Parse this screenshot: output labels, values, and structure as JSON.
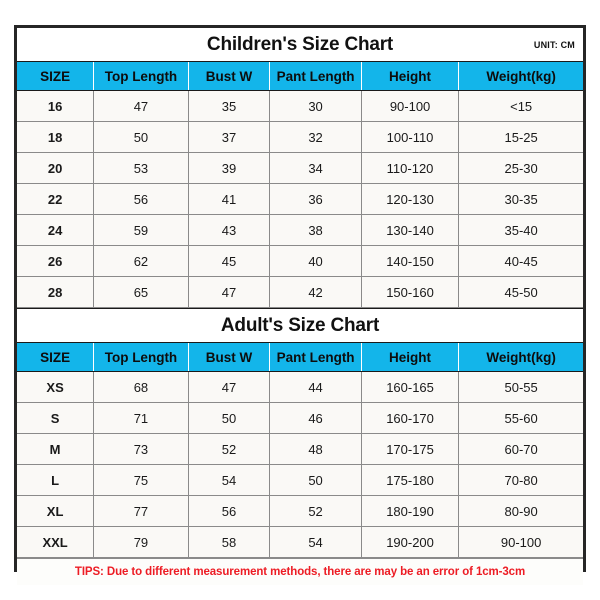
{
  "unit_note": "UNIT: CM",
  "columns": [
    "SIZE",
    "Top Length",
    "Bust W",
    "Pant Length",
    "Height",
    "Weight(kg)"
  ],
  "colors": {
    "header_blue": "#13B5EA",
    "cell_background": "#FAF9F6",
    "border_gray": "#8A8A8A",
    "outer_border": "#262626",
    "tips_red": "#ED1C24",
    "text_dark": "#1A1A1A"
  },
  "children_chart": {
    "title": "Children's Size Chart",
    "columns": [
      "SIZE",
      "Top Length",
      "Bust W",
      "Pant Length",
      "Height",
      "Weight(kg)"
    ],
    "rows": [
      {
        "size": "16",
        "top_length": "47",
        "bust_w": "35",
        "pant_length": "30",
        "height": "90-100",
        "weight": "<15"
      },
      {
        "size": "18",
        "top_length": "50",
        "bust_w": "37",
        "pant_length": "32",
        "height": "100-110",
        "weight": "15-25"
      },
      {
        "size": "20",
        "top_length": "53",
        "bust_w": "39",
        "pant_length": "34",
        "height": "110-120",
        "weight": "25-30"
      },
      {
        "size": "22",
        "top_length": "56",
        "bust_w": "41",
        "pant_length": "36",
        "height": "120-130",
        "weight": "30-35"
      },
      {
        "size": "24",
        "top_length": "59",
        "bust_w": "43",
        "pant_length": "38",
        "height": "130-140",
        "weight": "35-40"
      },
      {
        "size": "26",
        "top_length": "62",
        "bust_w": "45",
        "pant_length": "40",
        "height": "140-150",
        "weight": "40-45"
      },
      {
        "size": "28",
        "top_length": "65",
        "bust_w": "47",
        "pant_length": "42",
        "height": "150-160",
        "weight": "45-50"
      }
    ]
  },
  "adult_chart": {
    "title": "Adult's Size Chart",
    "columns": [
      "SIZE",
      "Top Length",
      "Bust W",
      "Pant Length",
      "Height",
      "Weight(kg)"
    ],
    "rows": [
      {
        "size": "XS",
        "top_length": "68",
        "bust_w": "47",
        "pant_length": "44",
        "height": "160-165",
        "weight": "50-55"
      },
      {
        "size": "S",
        "top_length": "71",
        "bust_w": "50",
        "pant_length": "46",
        "height": "160-170",
        "weight": "55-60"
      },
      {
        "size": "M",
        "top_length": "73",
        "bust_w": "52",
        "pant_length": "48",
        "height": "170-175",
        "weight": "60-70"
      },
      {
        "size": "L",
        "top_length": "75",
        "bust_w": "54",
        "pant_length": "50",
        "height": "175-180",
        "weight": "70-80"
      },
      {
        "size": "XL",
        "top_length": "77",
        "bust_w": "56",
        "pant_length": "52",
        "height": "180-190",
        "weight": "80-90"
      },
      {
        "size": "XXL",
        "top_length": "79",
        "bust_w": "58",
        "pant_length": "54",
        "height": "190-200",
        "weight": "90-100"
      }
    ]
  },
  "tips": "TIPS: Due to different measurement methods, there are may be an error of 1cm-3cm"
}
